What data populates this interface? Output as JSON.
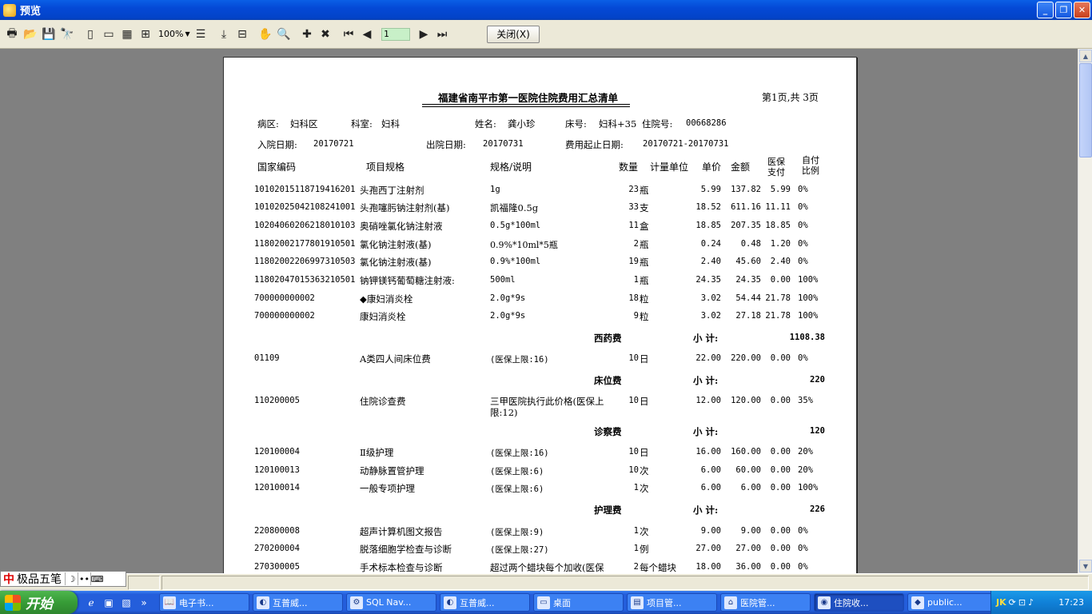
{
  "window": {
    "title": "预览",
    "controls": {
      "minimize": "_",
      "restore": "❐",
      "close": "✕"
    }
  },
  "toolbar": {
    "zoom": "100%",
    "page_number": "1",
    "close_label": "关闭(X)",
    "icons": [
      "print-icon",
      "open-icon",
      "save-icon",
      "find-icon",
      "single-page-icon",
      "two-page-icon",
      "four-page-icon",
      "multi-page-icon",
      "zoom-select",
      "page-width-icon",
      "export-icon",
      "outline-icon",
      "hand-icon",
      "zoom-in-icon",
      "new-icon",
      "delete-icon",
      "first-page-icon",
      "prev-page-icon",
      "next-page-icon",
      "last-page-icon"
    ]
  },
  "report": {
    "title": "福建省南平市第一医院住院费用汇总清单",
    "page_info": "第1页,共 3页",
    "info_row1": {
      "ward_label": "病区:",
      "ward_value": "妇科区",
      "dept_label": "科室:",
      "dept_value": "妇科",
      "name_label": "姓名:",
      "name_value": "龚小珍",
      "bed_label": "床号:",
      "bed_value": "妇科+35",
      "admission_no_label": "住院号:",
      "admission_no_value": "00668286"
    },
    "info_row2": {
      "admit_date_label": "入院日期:",
      "admit_date_value": "20170721",
      "discharge_date_label": "出院日期:",
      "discharge_date_value": "20170731",
      "fee_period_label": "费用起止日期:",
      "fee_period_value": "20170721-20170731"
    },
    "headers": {
      "code": "国家编码",
      "item": "项目规格",
      "spec": "规格/说明",
      "qty": "数量",
      "unit": "计量单位",
      "price": "单价",
      "amount": "金额",
      "insurance_line1": "医保",
      "insurance_line2": "支付",
      "self_line1": "自付",
      "self_line2": "比例"
    },
    "rows": [
      {
        "code": "10102015118719416201",
        "item": "头孢西丁注射剂",
        "spec": "1g",
        "qty": "23",
        "unit": "瓶",
        "price": "5.99",
        "amount": "137.82",
        "ins": "5.99",
        "ratio": "0%"
      },
      {
        "code": "10102025042108241001",
        "item": "头孢噻肟钠注射剂(基)",
        "spec": "凯福隆0.5g",
        "qty": "33",
        "unit": "支",
        "price": "18.52",
        "amount": "611.16",
        "ins": "11.11",
        "ratio": "0%"
      },
      {
        "code": "10204060206218010103",
        "item": "奥硝唑氯化钠注射液",
        "spec": "0.5g*100ml",
        "qty": "11",
        "unit": "盒",
        "price": "18.85",
        "amount": "207.35",
        "ins": "18.85",
        "ratio": "0%"
      },
      {
        "code": "11802002177801910501",
        "item": "氯化钠注射液(基)",
        "spec": "0.9%*10ml*5瓶",
        "qty": "2",
        "unit": "瓶",
        "price": "0.24",
        "amount": "0.48",
        "ins": "1.20",
        "ratio": "0%"
      },
      {
        "code": "11802002206997310503",
        "item": "氯化钠注射液(基)",
        "spec": "0.9%*100ml",
        "qty": "19",
        "unit": "瓶",
        "price": "2.40",
        "amount": "45.60",
        "ins": "2.40",
        "ratio": "0%"
      },
      {
        "code": "11802047015363210501",
        "item": "钠钾镁钙葡萄糖注射液:",
        "spec": "500ml",
        "qty": "1",
        "unit": "瓶",
        "price": "24.35",
        "amount": "24.35",
        "ins": "0.00",
        "ratio": "100%"
      },
      {
        "code": "700000000002",
        "item": "◆康妇消炎栓",
        "spec": "2.0g*9s",
        "qty": "18",
        "unit": "粒",
        "price": "3.02",
        "amount": "54.44",
        "ins": "21.78",
        "ratio": "100%"
      },
      {
        "code": "700000000002",
        "item": "康妇消炎栓",
        "spec": "2.0g*9s",
        "qty": "9",
        "unit": "粒",
        "price": "3.02",
        "amount": "27.18",
        "ins": "21.78",
        "ratio": "100%"
      },
      {
        "code": "01109",
        "item": "A类四人间床位费",
        "spec": "(医保上限:16)",
        "qty": "10",
        "unit": "日",
        "price": "22.00",
        "amount": "220.00",
        "ins": "0.00",
        "ratio": "0%"
      },
      {
        "code": "110200005",
        "item": "住院诊查费",
        "spec": "三甲医院执行此价格(医保上",
        "spec2": "限:12)",
        "qty": "10",
        "unit": "日",
        "price": "12.00",
        "amount": "120.00",
        "ins": "0.00",
        "ratio": "35%"
      },
      {
        "code": "120100004",
        "item": "Ⅱ级护理",
        "spec": "(医保上限:16)",
        "qty": "10",
        "unit": "日",
        "price": "16.00",
        "amount": "160.00",
        "ins": "0.00",
        "ratio": "20%"
      },
      {
        "code": "120100013",
        "item": "动静脉置管护理",
        "spec": "(医保上限:6)",
        "qty": "10",
        "unit": "次",
        "price": "6.00",
        "amount": "60.00",
        "ins": "0.00",
        "ratio": "20%"
      },
      {
        "code": "120100014",
        "item": "一般专项护理",
        "spec": "(医保上限:6)",
        "qty": "1",
        "unit": "次",
        "price": "6.00",
        "amount": "6.00",
        "ins": "0.00",
        "ratio": "100%"
      },
      {
        "code": "220800008",
        "item": "超声计算机图文报告",
        "spec": "(医保上限:9)",
        "qty": "1",
        "unit": "次",
        "price": "9.00",
        "amount": "9.00",
        "ins": "0.00",
        "ratio": "0%"
      },
      {
        "code": "270200004",
        "item": "脱落细胞学检查与诊断",
        "spec": "(医保上限:27)",
        "qty": "1",
        "unit": "例",
        "price": "27.00",
        "amount": "27.00",
        "ins": "0.00",
        "ratio": "0%"
      },
      {
        "code": "270300005",
        "item": "手术标本检查与诊断",
        "spec": "超过两个蜡块每个加收(医保",
        "qty": "2",
        "unit": "每个蜡块",
        "price": "18.00",
        "amount": "36.00",
        "ins": "0.00",
        "ratio": "0%"
      }
    ],
    "subtotal_label": "小  计:",
    "subtotals": [
      {
        "category": "西药费",
        "value": "1108.38"
      },
      {
        "category": "床位费",
        "value": "220"
      },
      {
        "category": "诊察费",
        "value": "120"
      },
      {
        "category": "护理费",
        "value": "226"
      }
    ]
  },
  "ime": {
    "logo": "中",
    "name": "极品五笔"
  },
  "taskbar": {
    "start_label": "开始",
    "tasks": [
      "电子书...",
      "互普威...",
      "SQL Nav...",
      "互普威...",
      "桌面",
      "项目管...",
      "医院管...",
      "住院收...",
      "public..."
    ],
    "tray_brand": "JK",
    "clock": "17:23"
  }
}
